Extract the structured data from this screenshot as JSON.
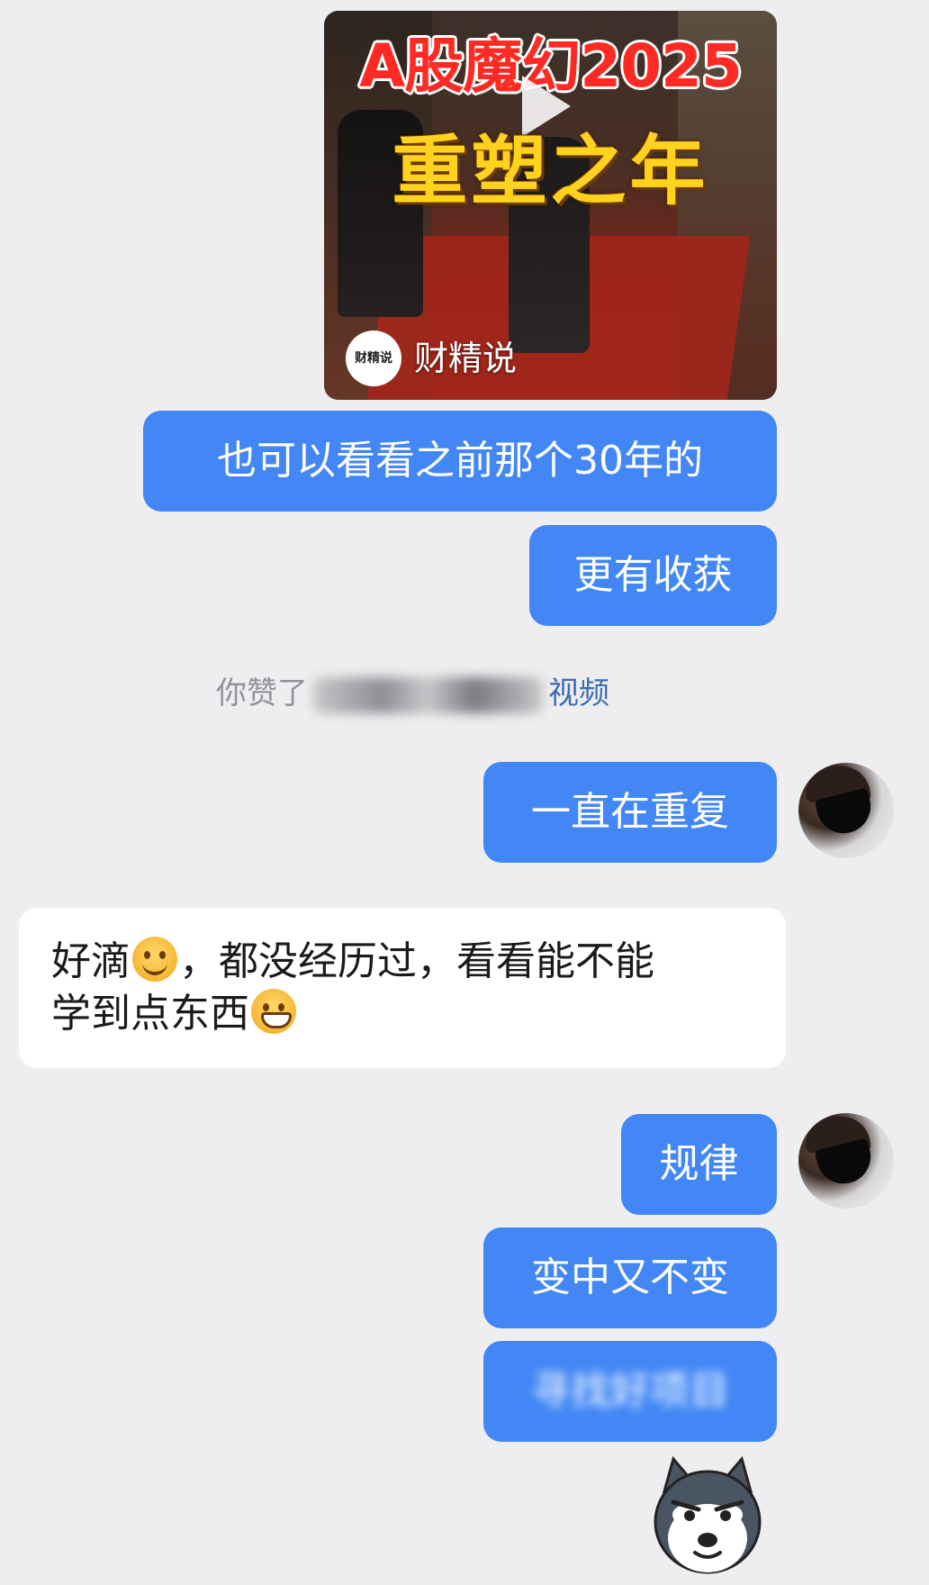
{
  "video_card": {
    "title_line1": "A股魔幻2025",
    "title_line2": "重塑之年",
    "channel_name": "财精说",
    "channel_logo_text": "财精说"
  },
  "messages": [
    {
      "id": "m1",
      "side": "out",
      "text": "也可以看看之前那个30年的"
    },
    {
      "id": "m2",
      "side": "out",
      "text": "更有收获"
    },
    {
      "id": "m3",
      "side": "out",
      "text": "一直在重复"
    },
    {
      "id": "m4_a",
      "side": "in",
      "text": "好滴"
    },
    {
      "id": "m4_b",
      "side": "in",
      "text": "，都没经历过，看看能不能"
    },
    {
      "id": "m4_c",
      "side": "in",
      "text": "学到点东西"
    },
    {
      "id": "m5",
      "side": "out",
      "text": "规律"
    },
    {
      "id": "m6",
      "side": "out",
      "text": "变中又不变"
    },
    {
      "id": "m7",
      "side": "out",
      "text": "寻找好项目"
    }
  ],
  "notice": {
    "prefix": "你赞了",
    "suffix": "视频"
  },
  "icons": {
    "play": "play-icon",
    "smile": "smile-emoji-icon",
    "grin": "grin-emoji-icon",
    "sticker": "husky-dog-sticker"
  },
  "colors": {
    "outgoing_bubble": "#4287f5",
    "incoming_bubble": "#ffffff",
    "background": "#eeeef0",
    "notice_link": "#3e6db3"
  }
}
